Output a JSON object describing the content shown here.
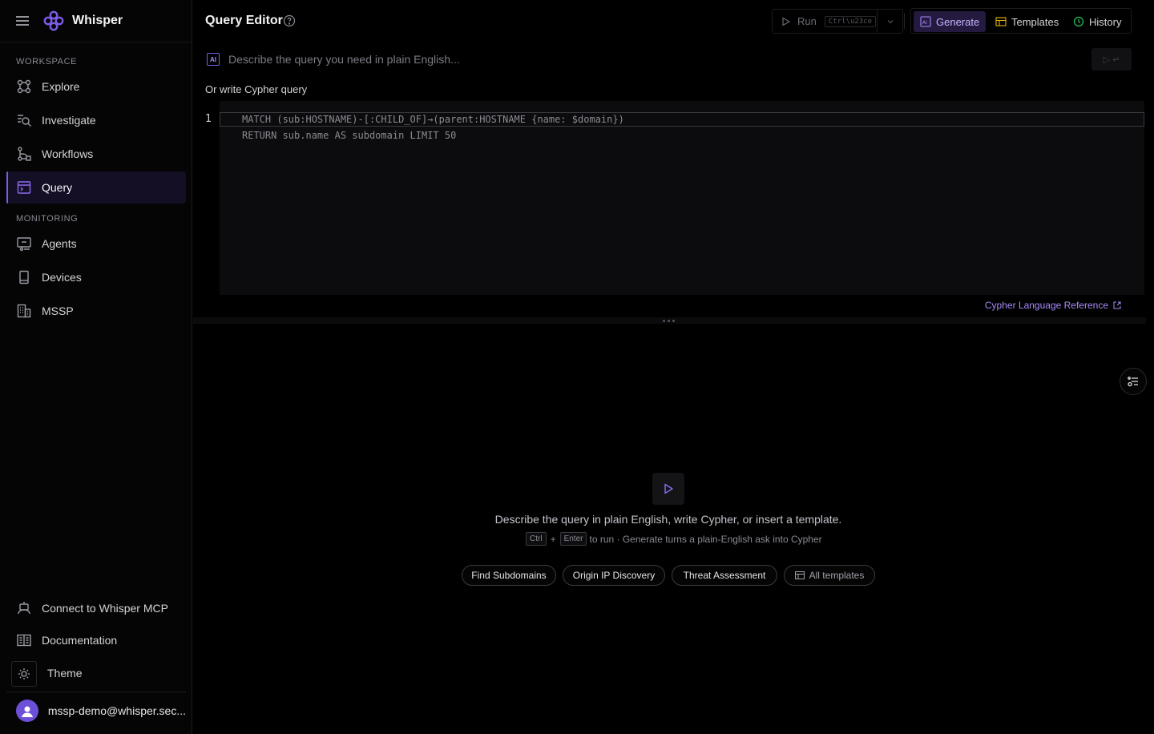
{
  "app": {
    "name": "Whisper"
  },
  "sidebar": {
    "workspace_label": "WORKSPACE",
    "monitoring_label": "MONITORING",
    "workspace_items": [
      {
        "label": "Explore",
        "icon": "graph-nodes-icon"
      },
      {
        "label": "Investigate",
        "icon": "search-list-icon"
      },
      {
        "label": "Workflows",
        "icon": "workflow-icon"
      },
      {
        "label": "Query",
        "icon": "terminal-window-icon",
        "active": true
      }
    ],
    "monitoring_items": [
      {
        "label": "Agents",
        "icon": "agent-screen-icon"
      },
      {
        "label": "Devices",
        "icon": "device-icon"
      },
      {
        "label": "MSSP",
        "icon": "building-icon"
      }
    ],
    "bottom": {
      "mcp": "Connect to Whisper MCP",
      "docs": "Documentation",
      "theme": "Theme",
      "user_email": "mssp-demo@whisper.sec..."
    }
  },
  "header": {
    "title": "Query Editor",
    "run_label": "Run",
    "run_shortcut": "Ctrl\\u23ce",
    "generate_label": "Generate",
    "templates_label": "Templates",
    "history_label": "History"
  },
  "prompt": {
    "ai_badge": "AI",
    "placeholder": "Describe the query you need in plain English...",
    "send_hint": "▷ ↵"
  },
  "editor": {
    "label": "Or write Cypher query",
    "line_numbers": [
      "1"
    ],
    "lines": [
      "MATCH (sub:HOSTNAME)-[:CHILD_OF]→(parent:HOSTNAME {name: $domain})",
      "RETURN sub.name AS subdomain LIMIT 50"
    ],
    "reference_link": "Cypher Language Reference"
  },
  "results": {
    "empty_message": "Describe the query in plain English, write Cypher, or insert a template.",
    "hint_key1": "Ctrl",
    "hint_plus": "+",
    "hint_key2": "Enter",
    "hint_text": "to run · Generate turns a plain-English ask into Cypher",
    "chips": [
      "Find Subdomains",
      "Origin IP Discovery",
      "Threat Assessment"
    ],
    "all_templates": "All templates"
  },
  "colors": {
    "accent": "#7c5ce6",
    "accent_light": "#a78bfa",
    "background": "#000000"
  }
}
